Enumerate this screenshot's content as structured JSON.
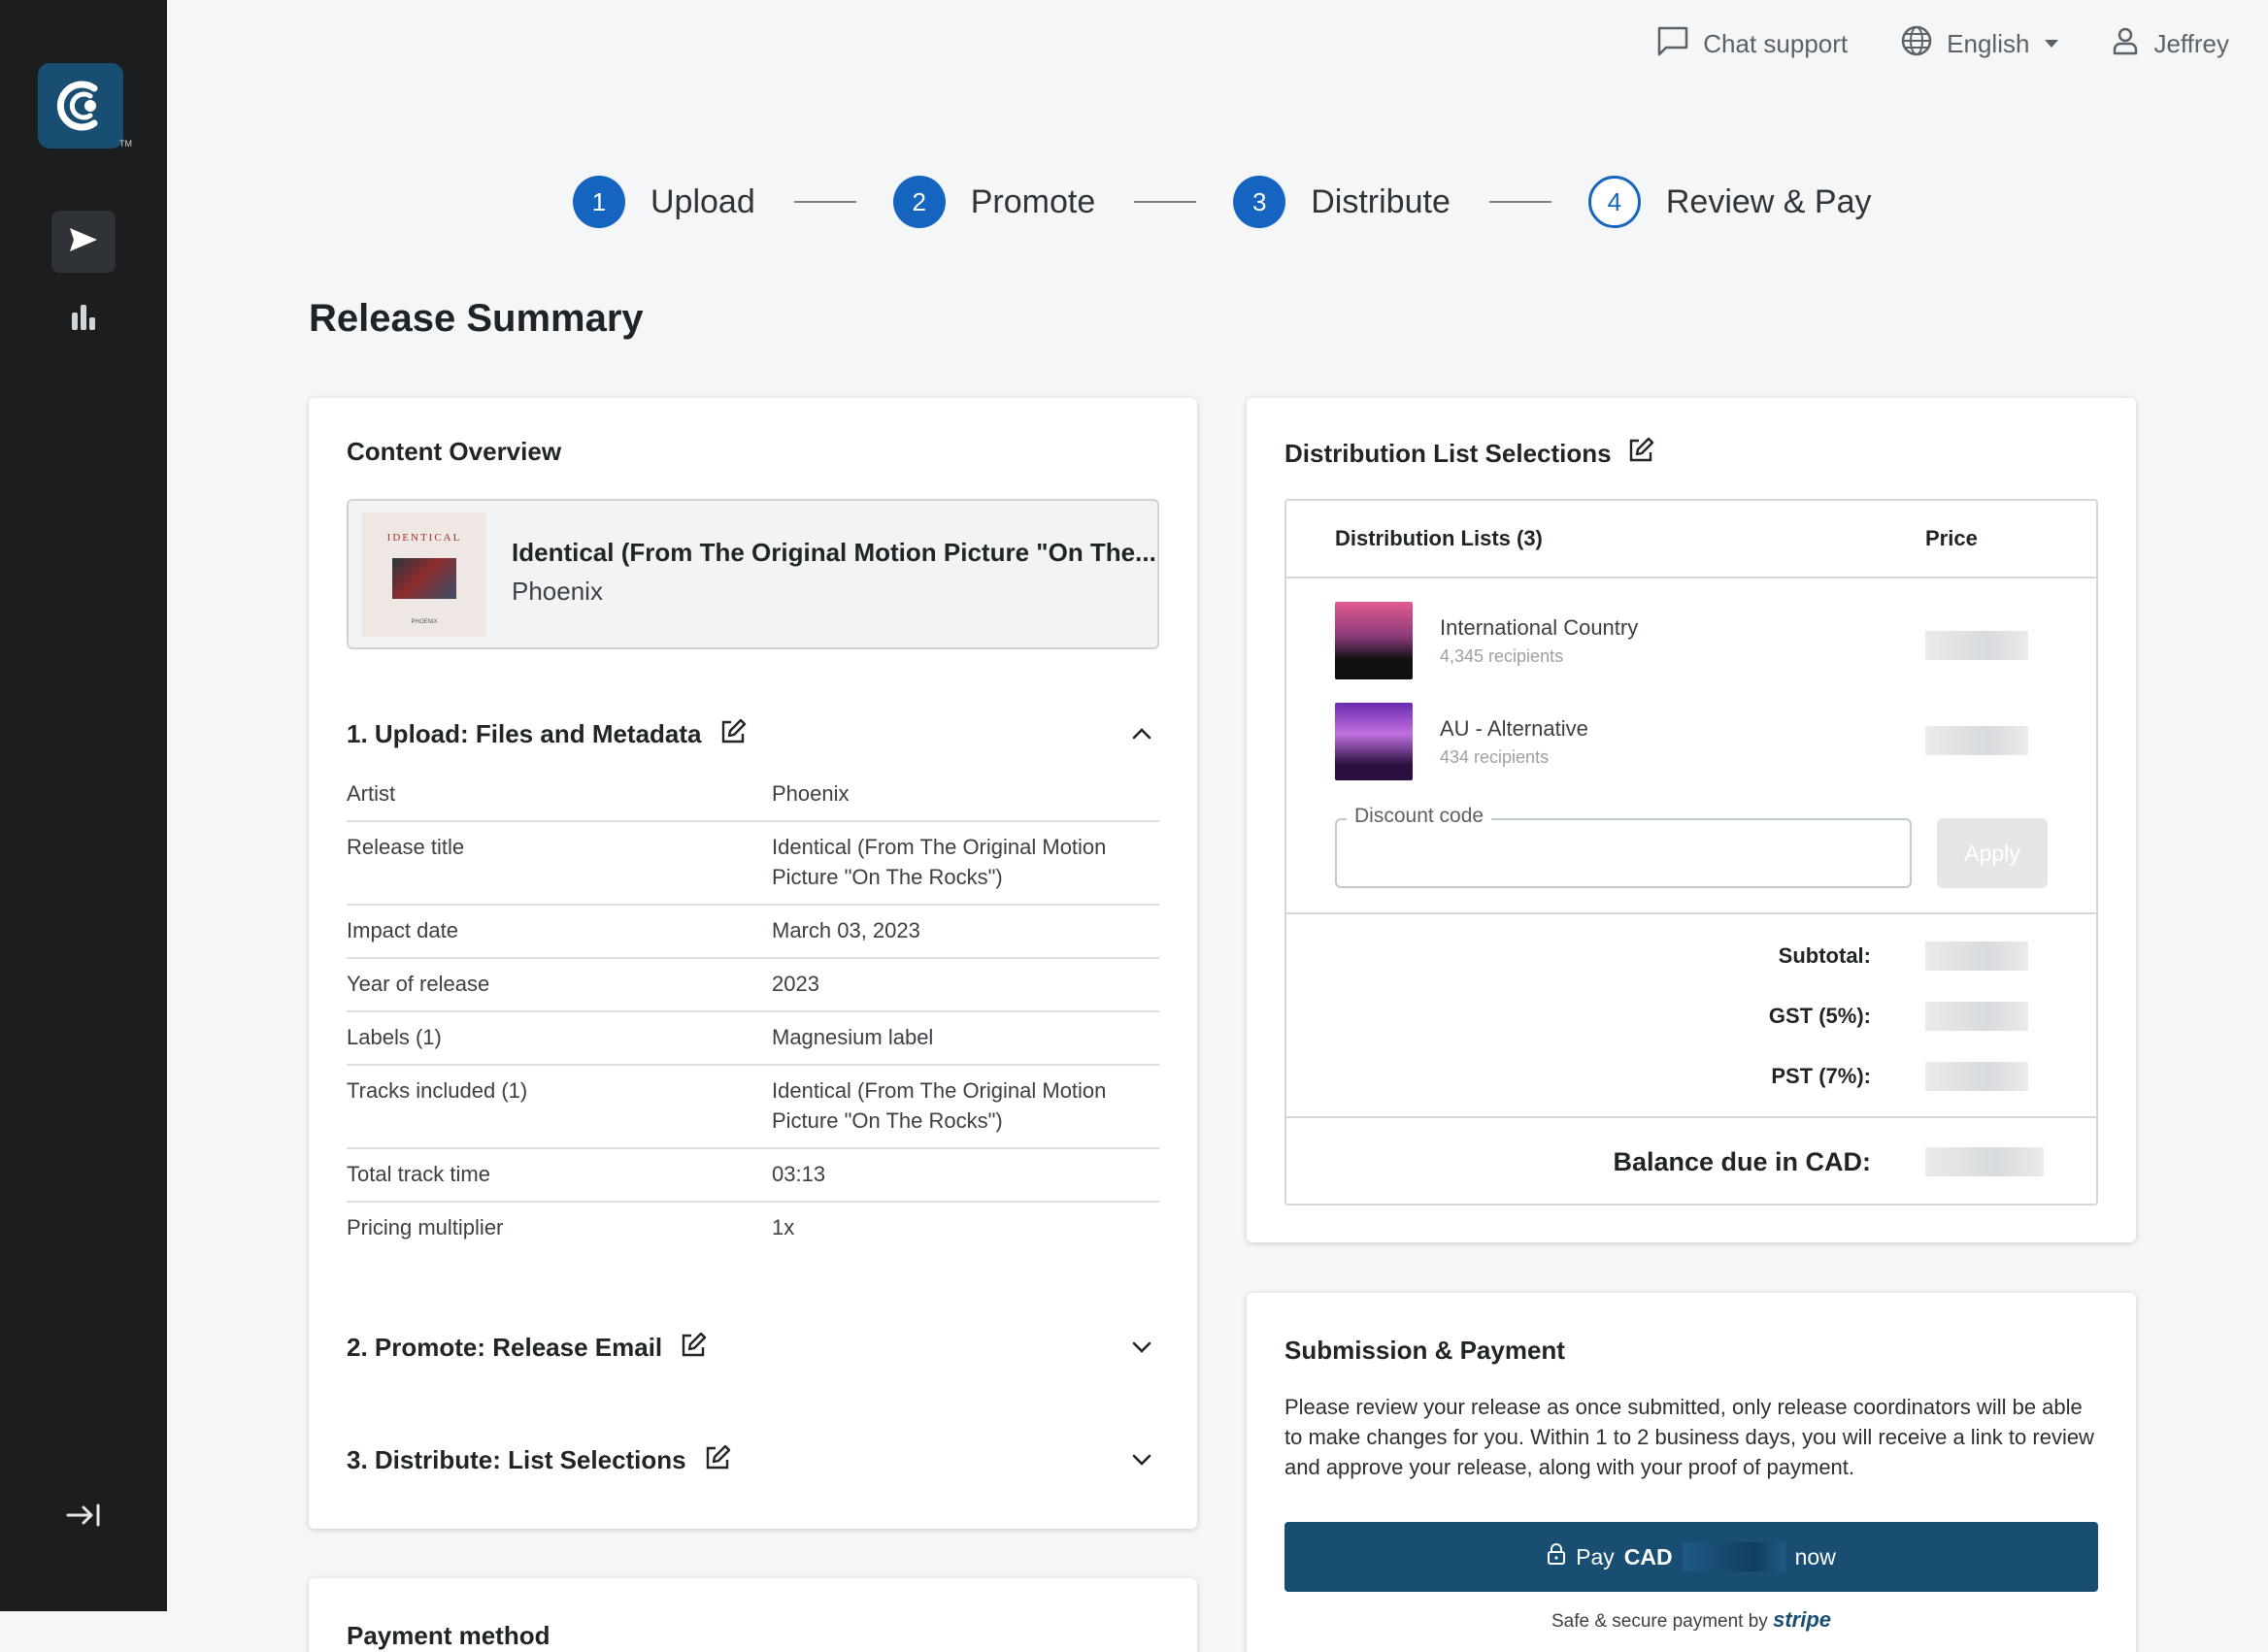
{
  "sidebar": {
    "logo_icon": "brand-logo-icon",
    "logo_tm": "TM",
    "items": [
      {
        "icon": "send-icon",
        "active": true
      },
      {
        "icon": "bar-chart-icon",
        "active": false
      }
    ],
    "collapse_icon": "expand-sidebar-icon"
  },
  "topbar": {
    "chat_label": "Chat support",
    "language_label": "English",
    "user_label": "Jeffrey"
  },
  "stepper": [
    {
      "num": "1",
      "label": "Upload",
      "state": "complete"
    },
    {
      "num": "2",
      "label": "Promote",
      "state": "complete"
    },
    {
      "num": "3",
      "label": "Distribute",
      "state": "complete"
    },
    {
      "num": "4",
      "label": "Review & Pay",
      "state": "current"
    }
  ],
  "page_title": "Release Summary",
  "content_overview": {
    "title": "Content Overview",
    "release": {
      "cover_title": "IDENTICAL",
      "cover_artist": "PHOENIX",
      "title": "Identical (From The Original Motion Picture \"On The...",
      "artist": "Phoenix"
    },
    "sections": [
      {
        "label": "1. Upload: Files and Metadata",
        "expanded": true
      },
      {
        "label": "2. Promote: Release Email",
        "expanded": false
      },
      {
        "label": "3. Distribute: List Selections",
        "expanded": false
      }
    ],
    "metadata": [
      {
        "key": "Artist",
        "value": "Phoenix"
      },
      {
        "key": "Release title",
        "value": "Identical (From The Original Motion Picture \"On The Rocks\")"
      },
      {
        "key": "Impact date",
        "value": "March 03, 2023"
      },
      {
        "key": "Year of release",
        "value": "2023"
      },
      {
        "key": "Labels (1)",
        "value": "Magnesium label"
      },
      {
        "key": "Tracks included (1)",
        "value": "Identical (From The Original Motion Picture \"On The Rocks\")"
      },
      {
        "key": "Total track time",
        "value": "03:13"
      },
      {
        "key": "Pricing multiplier",
        "value": "1x"
      }
    ]
  },
  "distribution": {
    "title": "Distribution List Selections",
    "col_lists": "Distribution Lists (3)",
    "col_price": "Price",
    "lists": [
      {
        "name": "International Country",
        "recipients": "4,345 recipients"
      },
      {
        "name": "AU - Alternative",
        "recipients": "434 recipients"
      }
    ],
    "discount_label": "Discount code",
    "discount_value": "",
    "apply_label": "Apply",
    "subtotal_label": "Subtotal:",
    "gst_label": "GST (5%):",
    "pst_label": "PST (7%):",
    "balance_label": "Balance due in CAD:"
  },
  "submission": {
    "title": "Submission & Payment",
    "text": "Please review your release as once submitted, only release coordinators will be able to make changes for you. Within 1 to 2 business days, you will receive a link to review and approve your release, along with your proof of payment.",
    "pay_prefix": "Pay",
    "pay_currency": "CAD",
    "pay_suffix": "now",
    "secure_text": "Safe & secure payment by",
    "secure_brand": "stripe"
  },
  "payment_method": {
    "title": "Payment method"
  },
  "colors": {
    "primary": "#1565c0",
    "brand_dark": "#184e72",
    "sidebar": "#1b1d1f"
  }
}
